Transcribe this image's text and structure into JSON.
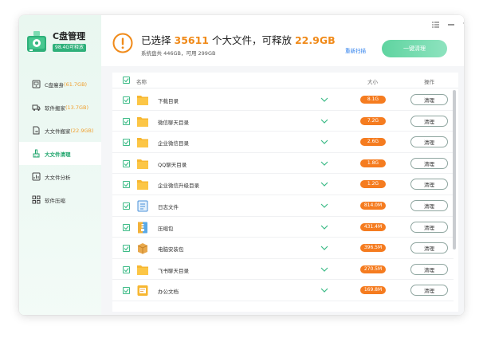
{
  "app": {
    "title": "C盘管理",
    "free_badge": "98.4G可释放"
  },
  "sidebar": {
    "items": [
      {
        "label": "C盘瘦身",
        "extra": "(61.7GB)",
        "icon": "disk-icon",
        "active": false
      },
      {
        "label": "软件搬家",
        "extra": "(13.7GB)",
        "icon": "truck-icon",
        "active": false
      },
      {
        "label": "大文件搬家",
        "extra": "(22.9GB)",
        "icon": "file-move-icon",
        "active": false
      },
      {
        "label": "大文件清理",
        "extra": "",
        "icon": "broom-icon",
        "active": true
      },
      {
        "label": "大文件分析",
        "extra": "",
        "icon": "chart-icon",
        "active": false
      },
      {
        "label": "软件压缩",
        "extra": "",
        "icon": "apps-icon",
        "active": false
      }
    ]
  },
  "summary": {
    "prefix": "已选择",
    "count": "35611",
    "mid": "个大文件，可释放",
    "size": "22.9GB",
    "disk_info": "系统盘共 446GB，可用 299GB"
  },
  "actions": {
    "rescan": "重新扫描",
    "clean_all": "一键清理"
  },
  "list": {
    "headers": {
      "name": "名称",
      "size": "大小",
      "action": "操作"
    },
    "clean_label": "清理",
    "rows": [
      {
        "name": "下载目录",
        "size": "8.1G",
        "icon": "folder-icon"
      },
      {
        "name": "微信聊天目录",
        "size": "7.2G",
        "icon": "folder-icon"
      },
      {
        "name": "企业微信目录",
        "size": "2.6G",
        "icon": "folder-icon"
      },
      {
        "name": "QQ聊天目录",
        "size": "1.8G",
        "icon": "folder-icon"
      },
      {
        "name": "企业微信升级目录",
        "size": "1.2G",
        "icon": "folder-icon"
      },
      {
        "name": "日志文件",
        "size": "814.0M",
        "icon": "log-file-icon"
      },
      {
        "name": "压缩包",
        "size": "431.4M",
        "icon": "archive-icon"
      },
      {
        "name": "电脑安装包",
        "size": "396.5M",
        "icon": "package-icon"
      },
      {
        "name": "飞书聊天目录",
        "size": "270.5M",
        "icon": "folder-icon"
      },
      {
        "name": "办公文档",
        "size": "169.8M",
        "icon": "document-icon"
      }
    ]
  },
  "colors": {
    "accent_green": "#1fa56c",
    "orange": "#f08a19",
    "size_badge": "#f57c20"
  }
}
